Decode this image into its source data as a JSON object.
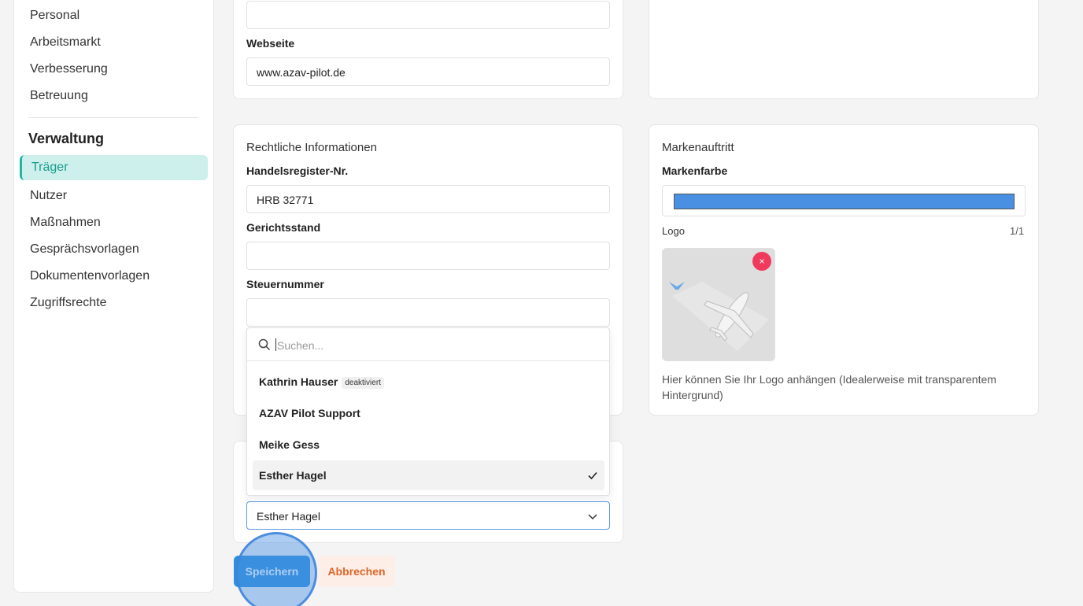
{
  "sidebar": {
    "items_top": [
      {
        "label": "Personal"
      },
      {
        "label": "Arbeitsmarkt"
      },
      {
        "label": "Verbesserung"
      },
      {
        "label": "Betreuung"
      }
    ],
    "section_title": "Verwaltung",
    "active_item": "Träger",
    "items_bottom": [
      {
        "label": "Nutzer"
      },
      {
        "label": "Maßnahmen"
      },
      {
        "label": "Gesprächsvorlagen"
      },
      {
        "label": "Dokumentenvorlagen"
      },
      {
        "label": "Zugriffsrechte"
      }
    ]
  },
  "contact": {
    "website_label": "Webseite",
    "website_value": "www.azav-pilot.de"
  },
  "legal": {
    "title": "Rechtliche Informationen",
    "register_label": "Handelsregister-Nr.",
    "register_value": "HRB 32771",
    "court_label": "Gerichtsstand",
    "court_value": "",
    "tax_label": "Steuernummer",
    "tax_value": ""
  },
  "dropdown": {
    "search_placeholder": "Suchen...",
    "options": [
      {
        "name": "Kathrin Hauser",
        "badge": "deaktiviert"
      },
      {
        "name": "AZAV Pilot Support"
      },
      {
        "name": "Meike Gess"
      },
      {
        "name": "Esther Hagel",
        "selected": true
      }
    ],
    "selected_value": "Esther Hagel"
  },
  "brand": {
    "title": "Markenauftritt",
    "color_label": "Markenfarbe",
    "color_value": "#4a90e2",
    "logo_label": "Logo",
    "logo_count": "1/1",
    "remove_symbol": "×",
    "hint": "Hier können Sie Ihr Logo anhängen (Idealerweise mit transparentem Hintergrund)"
  },
  "actions": {
    "save_label": "Speichern",
    "cancel_label": "Abbrechen"
  }
}
